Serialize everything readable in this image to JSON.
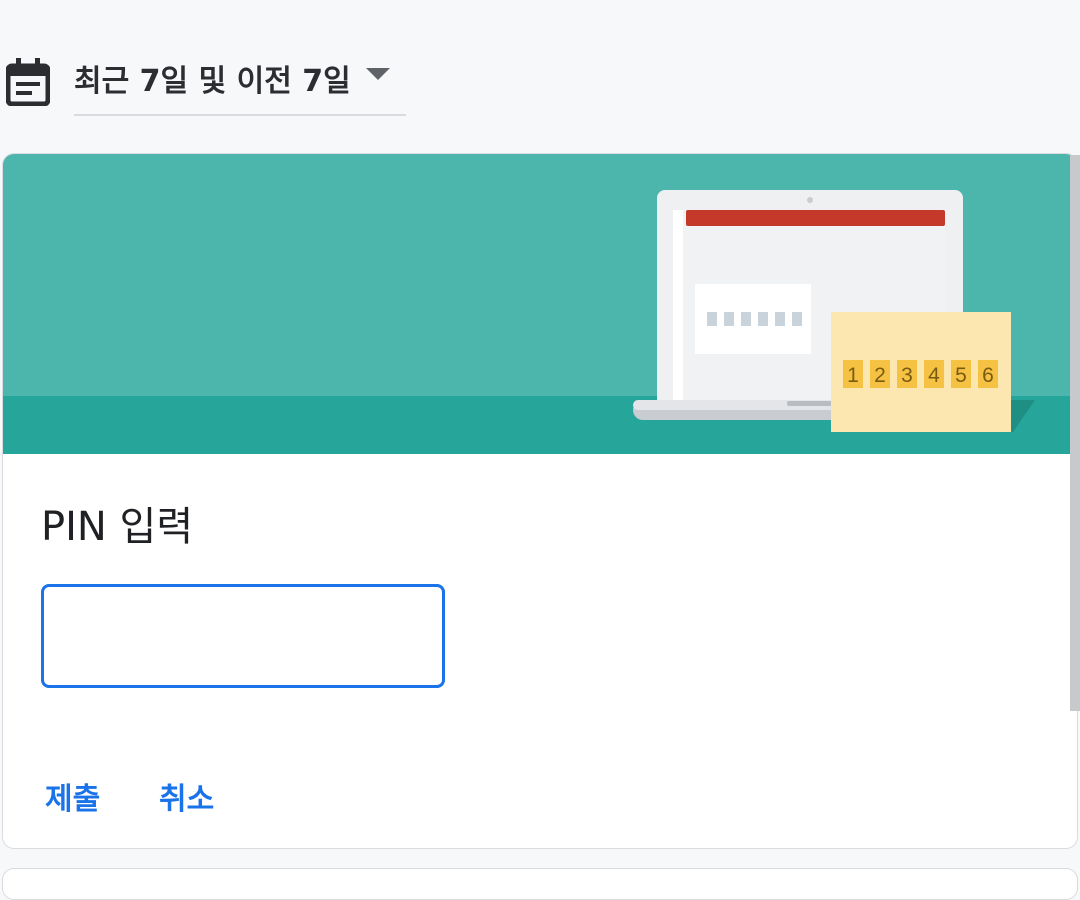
{
  "date_range": {
    "label": "최근 7일 및 이전 7일",
    "icon": "calendar-icon",
    "arrow_icon": "dropdown-arrow-icon"
  },
  "pin_card": {
    "title": "PIN 입력",
    "input_value": "",
    "illustration_digits": [
      "1",
      "2",
      "3",
      "4",
      "5",
      "6"
    ],
    "submit_label": "제출",
    "cancel_label": "취소"
  },
  "colors": {
    "accent": "#1a73e8",
    "banner": "#4db6ac",
    "banner_strip": "#26a69a",
    "laptop_bar": "#c5392b",
    "note": "#fde7b0",
    "digit_box": "#f6c244"
  }
}
